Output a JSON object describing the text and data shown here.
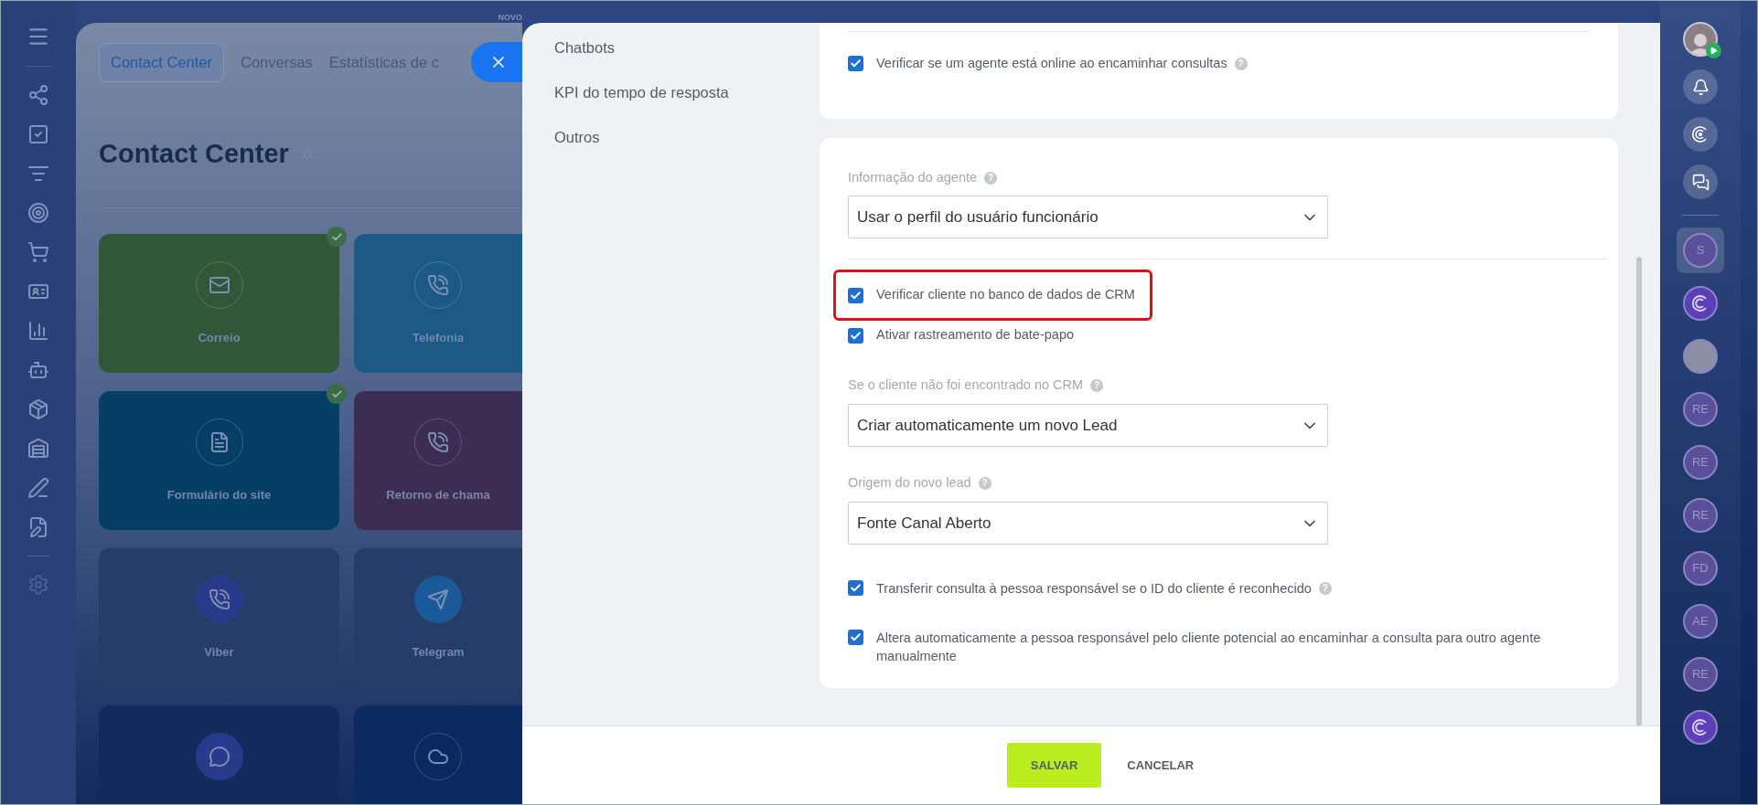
{
  "background": {
    "badge": "NOVO",
    "tabs": [
      {
        "label": "Contact Center",
        "selected": true
      },
      {
        "label": "Conversas",
        "selected": false
      },
      {
        "label": "Estatísticas de c",
        "selected": false
      }
    ],
    "title": "Contact Center",
    "tiles": [
      {
        "label": "Correio",
        "kind": "mail",
        "checked": true,
        "color": "#2f5738"
      },
      {
        "label": "Telefonia",
        "kind": "phone",
        "checked": false,
        "color": "#1c5a85"
      },
      {
        "label": "Formulário do site",
        "kind": "form",
        "checked": true,
        "color": "#063f66"
      },
      {
        "label": "Retorno de chama",
        "kind": "phone",
        "checked": false,
        "color": "#3d2d52"
      },
      {
        "label": "Viber",
        "kind": "viber",
        "checked": false,
        "color": "#263d6a"
      },
      {
        "label": "Telegram",
        "kind": "telegram",
        "checked": false,
        "color": "#263d6a"
      },
      {
        "kind": "chat",
        "checked": false,
        "color": "#142a5c"
      },
      {
        "kind": "cloud",
        "checked": false,
        "color": "#0b2a62"
      }
    ]
  },
  "settings_menu": [
    "Chatbots",
    "KPI do tempo de resposta",
    "Outros"
  ],
  "online_check": {
    "label": "Verificar se um agente está online ao encaminhar consultas",
    "checked": true,
    "help": "?"
  },
  "agent_info": {
    "label": "Informação do agente",
    "help": "?",
    "value": "Usar o perfil do usuário funcionário"
  },
  "crm_checks": [
    {
      "label": "Verificar cliente no banco de dados de CRM",
      "checked": true,
      "highlighted": true
    },
    {
      "label": "Ativar rastreamento de bate-papo",
      "checked": true,
      "highlighted": false
    }
  ],
  "selects": [
    {
      "label": "Se o cliente não foi encontrado no CRM",
      "help": "?",
      "value": "Criar automaticamente um novo Lead"
    },
    {
      "label": "Origem do novo lead",
      "help": "?",
      "value": "Fonte Canal Aberto"
    }
  ],
  "bottom_checks": [
    {
      "label": "Transferir consulta à pessoa responsável se o ID do cliente é reconhecido",
      "checked": true,
      "help": "?"
    },
    {
      "label": "Altera automaticamente a pessoa responsável pelo cliente potencial ao encaminhar a consulta para outro agente manualmente",
      "checked": true
    }
  ],
  "footer": {
    "buttons": [
      {
        "label": "SALVAR",
        "kind": "primary"
      },
      {
        "label": "CANCELAR",
        "kind": "link"
      }
    ]
  },
  "right_bar": [
    {
      "kind": "user"
    },
    {
      "kind": "bell"
    },
    {
      "kind": "copilot"
    },
    {
      "kind": "chat"
    },
    {
      "kind": "divider"
    },
    {
      "kind": "initials",
      "text": "S",
      "selected": true
    },
    {
      "kind": "logo"
    },
    {
      "kind": "photo"
    },
    {
      "kind": "initials",
      "text": "RE",
      "selected": false
    },
    {
      "kind": "initials",
      "text": "RE",
      "selected": false
    },
    {
      "kind": "initials",
      "text": "RE",
      "selected": false
    },
    {
      "kind": "initials",
      "text": "FD",
      "selected": false
    },
    {
      "kind": "initials",
      "text": "AE",
      "selected": false
    },
    {
      "kind": "initials",
      "text": "RE",
      "selected": false
    },
    {
      "kind": "logo"
    }
  ]
}
